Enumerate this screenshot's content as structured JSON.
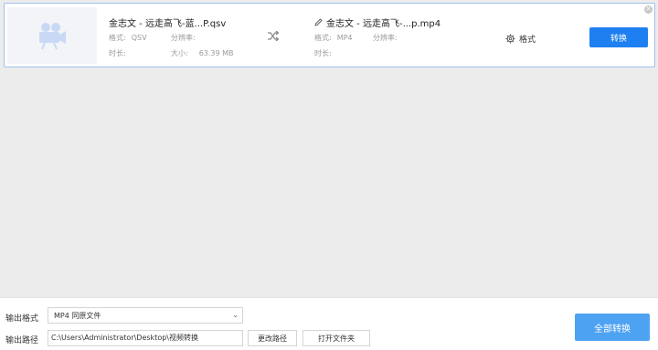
{
  "file": {
    "source_name": "金志文 - 远走高飞-蓝...P.qsv",
    "source_format_label": "格式:",
    "source_format": "QSV",
    "source_resolution_label": "分辨率:",
    "source_resolution": "",
    "source_duration_label": "时长:",
    "source_duration": "",
    "source_size_label": "大小:",
    "source_size": "63.39 MB",
    "output_name": "金志文 - 远走高飞-...p.mp4",
    "output_format_label": "格式:",
    "output_format": "MP4",
    "output_resolution_label": "分辨率:",
    "output_resolution": "",
    "output_duration_label": "时长:",
    "output_duration": "",
    "format_settings_label": "格式",
    "convert_label": "转换"
  },
  "bottom": {
    "output_format_label": "输出格式",
    "output_format_value": "MP4  同原文件",
    "output_path_label": "输出路径",
    "output_path_value": "C:\\Users\\Administrator\\Desktop\\视频转换",
    "change_path_label": "更改路径",
    "open_folder_label": "打开文件夹",
    "convert_all_label": "全部转换"
  },
  "colors": {
    "accent": "#1e7ff0",
    "accent_light": "#4ea2f2",
    "card_border": "#9ec1ee"
  },
  "icons": {
    "thumbnail": "video-camera-icon",
    "swap": "shuffle-icon",
    "edit": "pencil-icon",
    "settings": "gear-icon",
    "close": "close-icon",
    "dropdown": "chevron-down-icon"
  }
}
